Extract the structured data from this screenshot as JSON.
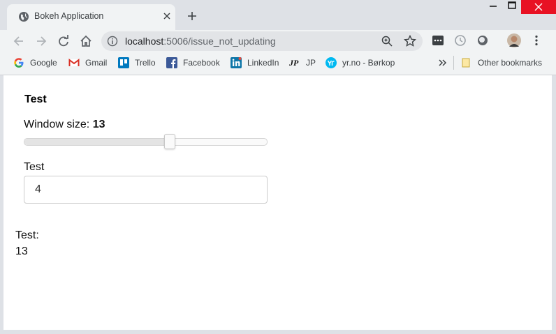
{
  "browser": {
    "tab": {
      "title": "Bokeh Application"
    },
    "address": {
      "host": "localhost",
      "rest": ":5006/issue_not_updating"
    },
    "bookmarks": [
      {
        "label": "Google",
        "icon": "google-icon"
      },
      {
        "label": "Gmail",
        "icon": "gmail-icon"
      },
      {
        "label": "Trello",
        "icon": "trello-icon"
      },
      {
        "label": "Facebook",
        "icon": "facebook-icon"
      },
      {
        "label": "LinkedIn",
        "icon": "linkedin-icon"
      },
      {
        "label": "JP",
        "icon": "jp-icon"
      },
      {
        "label": "yr.no - Børkop",
        "icon": "yr-icon"
      }
    ],
    "other_bookmarks": "Other bookmarks",
    "colors": {
      "close_red": "#e81123",
      "tab_bg": "#f1f3f4",
      "frame_bg": "#dee1e6"
    }
  },
  "page": {
    "heading": "Test",
    "slider": {
      "label": "Window size: ",
      "value": "13",
      "fraction": 0.6
    },
    "input": {
      "label": "Test",
      "value": "4"
    },
    "output": {
      "label": "Test:",
      "value": "13"
    }
  }
}
